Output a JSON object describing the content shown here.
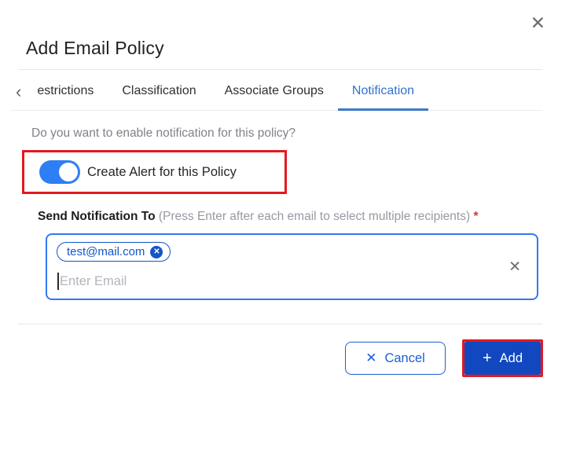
{
  "dialog": {
    "title": "Add Email Policy"
  },
  "icons": {
    "close": "✕",
    "back_chevron": "‹",
    "chip_remove": "✕",
    "clear_field": "✕",
    "cancel_x": "✕",
    "add_plus": "+"
  },
  "tabs": {
    "items": [
      {
        "label": "estrictions",
        "active": false
      },
      {
        "label": "Classification",
        "active": false
      },
      {
        "label": "Associate Groups",
        "active": false
      },
      {
        "label": "Notification",
        "active": true
      }
    ]
  },
  "notification_panel": {
    "question": "Do you want to enable notification for this policy?",
    "toggle": {
      "label": "Create Alert for this Policy",
      "state": "on"
    },
    "field": {
      "label": "Send Notification To",
      "hint": "(Press Enter after each email to select multiple recipients)",
      "required_marker": "*",
      "chips": [
        {
          "label": "test@mail.com"
        }
      ],
      "placeholder": "Enter Email",
      "value": ""
    }
  },
  "footer": {
    "cancel_label": "Cancel",
    "add_label": "Add"
  },
  "colors": {
    "accent_blue": "#2f71cf",
    "toggle_blue": "#2e7ef5",
    "field_border_blue": "#3179ef",
    "chip_blue": "#1256c8",
    "cancel_blue": "#1d5fd3",
    "add_button_blue": "#1148c0",
    "highlight_red": "#e4191f",
    "required_red": "#e03131"
  }
}
